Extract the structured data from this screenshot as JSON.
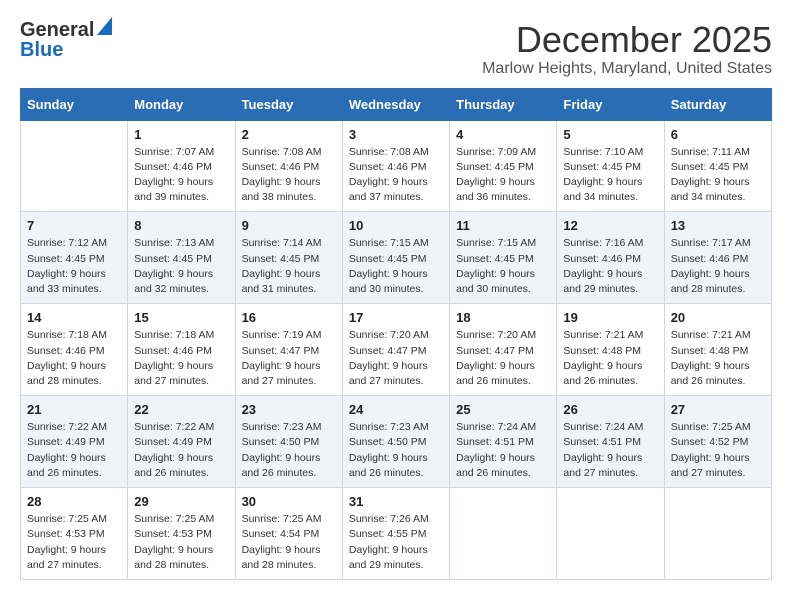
{
  "logo": {
    "line1": "General",
    "line2": "Blue"
  },
  "title": "December 2025",
  "subtitle": "Marlow Heights, Maryland, United States",
  "days_of_week": [
    "Sunday",
    "Monday",
    "Tuesday",
    "Wednesday",
    "Thursday",
    "Friday",
    "Saturday"
  ],
  "weeks": [
    [
      {
        "day": "",
        "info": ""
      },
      {
        "day": "1",
        "info": "Sunrise: 7:07 AM\nSunset: 4:46 PM\nDaylight: 9 hours\nand 39 minutes."
      },
      {
        "day": "2",
        "info": "Sunrise: 7:08 AM\nSunset: 4:46 PM\nDaylight: 9 hours\nand 38 minutes."
      },
      {
        "day": "3",
        "info": "Sunrise: 7:08 AM\nSunset: 4:46 PM\nDaylight: 9 hours\nand 37 minutes."
      },
      {
        "day": "4",
        "info": "Sunrise: 7:09 AM\nSunset: 4:45 PM\nDaylight: 9 hours\nand 36 minutes."
      },
      {
        "day": "5",
        "info": "Sunrise: 7:10 AM\nSunset: 4:45 PM\nDaylight: 9 hours\nand 34 minutes."
      },
      {
        "day": "6",
        "info": "Sunrise: 7:11 AM\nSunset: 4:45 PM\nDaylight: 9 hours\nand 34 minutes."
      }
    ],
    [
      {
        "day": "7",
        "info": "Sunrise: 7:12 AM\nSunset: 4:45 PM\nDaylight: 9 hours\nand 33 minutes."
      },
      {
        "day": "8",
        "info": "Sunrise: 7:13 AM\nSunset: 4:45 PM\nDaylight: 9 hours\nand 32 minutes."
      },
      {
        "day": "9",
        "info": "Sunrise: 7:14 AM\nSunset: 4:45 PM\nDaylight: 9 hours\nand 31 minutes."
      },
      {
        "day": "10",
        "info": "Sunrise: 7:15 AM\nSunset: 4:45 PM\nDaylight: 9 hours\nand 30 minutes."
      },
      {
        "day": "11",
        "info": "Sunrise: 7:15 AM\nSunset: 4:45 PM\nDaylight: 9 hours\nand 30 minutes."
      },
      {
        "day": "12",
        "info": "Sunrise: 7:16 AM\nSunset: 4:46 PM\nDaylight: 9 hours\nand 29 minutes."
      },
      {
        "day": "13",
        "info": "Sunrise: 7:17 AM\nSunset: 4:46 PM\nDaylight: 9 hours\nand 28 minutes."
      }
    ],
    [
      {
        "day": "14",
        "info": "Sunrise: 7:18 AM\nSunset: 4:46 PM\nDaylight: 9 hours\nand 28 minutes."
      },
      {
        "day": "15",
        "info": "Sunrise: 7:18 AM\nSunset: 4:46 PM\nDaylight: 9 hours\nand 27 minutes."
      },
      {
        "day": "16",
        "info": "Sunrise: 7:19 AM\nSunset: 4:47 PM\nDaylight: 9 hours\nand 27 minutes."
      },
      {
        "day": "17",
        "info": "Sunrise: 7:20 AM\nSunset: 4:47 PM\nDaylight: 9 hours\nand 27 minutes."
      },
      {
        "day": "18",
        "info": "Sunrise: 7:20 AM\nSunset: 4:47 PM\nDaylight: 9 hours\nand 26 minutes."
      },
      {
        "day": "19",
        "info": "Sunrise: 7:21 AM\nSunset: 4:48 PM\nDaylight: 9 hours\nand 26 minutes."
      },
      {
        "day": "20",
        "info": "Sunrise: 7:21 AM\nSunset: 4:48 PM\nDaylight: 9 hours\nand 26 minutes."
      }
    ],
    [
      {
        "day": "21",
        "info": "Sunrise: 7:22 AM\nSunset: 4:49 PM\nDaylight: 9 hours\nand 26 minutes."
      },
      {
        "day": "22",
        "info": "Sunrise: 7:22 AM\nSunset: 4:49 PM\nDaylight: 9 hours\nand 26 minutes."
      },
      {
        "day": "23",
        "info": "Sunrise: 7:23 AM\nSunset: 4:50 PM\nDaylight: 9 hours\nand 26 minutes."
      },
      {
        "day": "24",
        "info": "Sunrise: 7:23 AM\nSunset: 4:50 PM\nDaylight: 9 hours\nand 26 minutes."
      },
      {
        "day": "25",
        "info": "Sunrise: 7:24 AM\nSunset: 4:51 PM\nDaylight: 9 hours\nand 26 minutes."
      },
      {
        "day": "26",
        "info": "Sunrise: 7:24 AM\nSunset: 4:51 PM\nDaylight: 9 hours\nand 27 minutes."
      },
      {
        "day": "27",
        "info": "Sunrise: 7:25 AM\nSunset: 4:52 PM\nDaylight: 9 hours\nand 27 minutes."
      }
    ],
    [
      {
        "day": "28",
        "info": "Sunrise: 7:25 AM\nSunset: 4:53 PM\nDaylight: 9 hours\nand 27 minutes."
      },
      {
        "day": "29",
        "info": "Sunrise: 7:25 AM\nSunset: 4:53 PM\nDaylight: 9 hours\nand 28 minutes."
      },
      {
        "day": "30",
        "info": "Sunrise: 7:25 AM\nSunset: 4:54 PM\nDaylight: 9 hours\nand 28 minutes."
      },
      {
        "day": "31",
        "info": "Sunrise: 7:26 AM\nSunset: 4:55 PM\nDaylight: 9 hours\nand 29 minutes."
      },
      {
        "day": "",
        "info": ""
      },
      {
        "day": "",
        "info": ""
      },
      {
        "day": "",
        "info": ""
      }
    ]
  ]
}
